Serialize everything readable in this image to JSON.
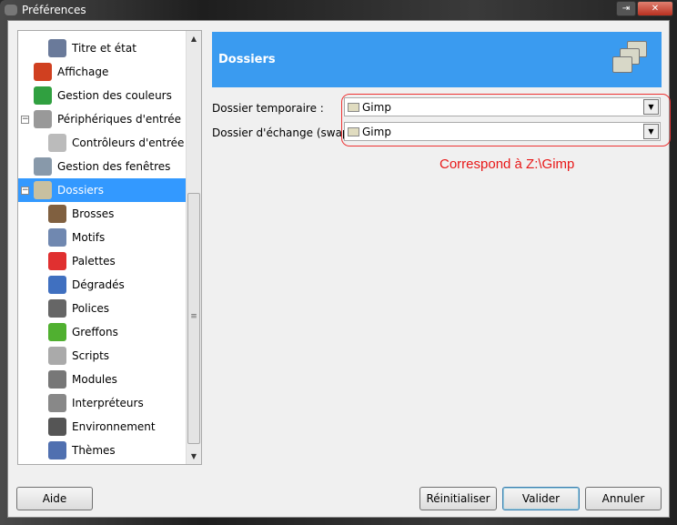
{
  "window": {
    "title": "Préférences"
  },
  "tree": {
    "items": [
      {
        "label": "Titre et état",
        "icon": "title-status-icon",
        "color": "#6a7a9a"
      },
      {
        "label": "Affichage",
        "icon": "display-icon",
        "color": "#d04020"
      },
      {
        "label": "Gestion des couleurs",
        "icon": "color-management-icon",
        "color": "#30a040"
      },
      {
        "label": "Périphériques d'entrée",
        "icon": "input-devices-icon",
        "color": "#999999"
      },
      {
        "label": "Contrôleurs d'entrée",
        "icon": "input-controllers-icon",
        "color": "#bbbbbb"
      },
      {
        "label": "Gestion des fenêtres",
        "icon": "window-management-icon",
        "color": "#8899aa"
      },
      {
        "label": "Dossiers",
        "icon": "folders-icon",
        "color": "#c8c0a0"
      },
      {
        "label": "Brosses",
        "icon": "brush-icon",
        "color": "#806040"
      },
      {
        "label": "Motifs",
        "icon": "patterns-icon",
        "color": "#7088b0"
      },
      {
        "label": "Palettes",
        "icon": "palettes-icon",
        "color": "#e03030"
      },
      {
        "label": "Dégradés",
        "icon": "gradients-icon",
        "color": "#4070c0"
      },
      {
        "label": "Polices",
        "icon": "fonts-icon",
        "color": "#666666"
      },
      {
        "label": "Greffons",
        "icon": "plugins-icon",
        "color": "#50b030"
      },
      {
        "label": "Scripts",
        "icon": "scripts-icon",
        "color": "#aaaaaa"
      },
      {
        "label": "Modules",
        "icon": "modules-icon",
        "color": "#777777"
      },
      {
        "label": "Interpréteurs",
        "icon": "interpreters-icon",
        "color": "#888888"
      },
      {
        "label": "Environnement",
        "icon": "environment-icon",
        "color": "#555555"
      },
      {
        "label": "Thèmes",
        "icon": "themes-icon",
        "color": "#5070b0"
      }
    ]
  },
  "main": {
    "title": "Dossiers",
    "temp_label": "Dossier temporaire :",
    "temp_value": "Gimp",
    "swap_label": "Dossier d'échange (swap) :",
    "swap_value": "Gimp",
    "annotation": "Correspond à Z:\\Gimp"
  },
  "buttons": {
    "help": "Aide",
    "reset": "Réinitialiser",
    "ok": "Valider",
    "cancel": "Annuler"
  },
  "colors": {
    "accent": "#3399ff",
    "annotation": "#e81818"
  }
}
